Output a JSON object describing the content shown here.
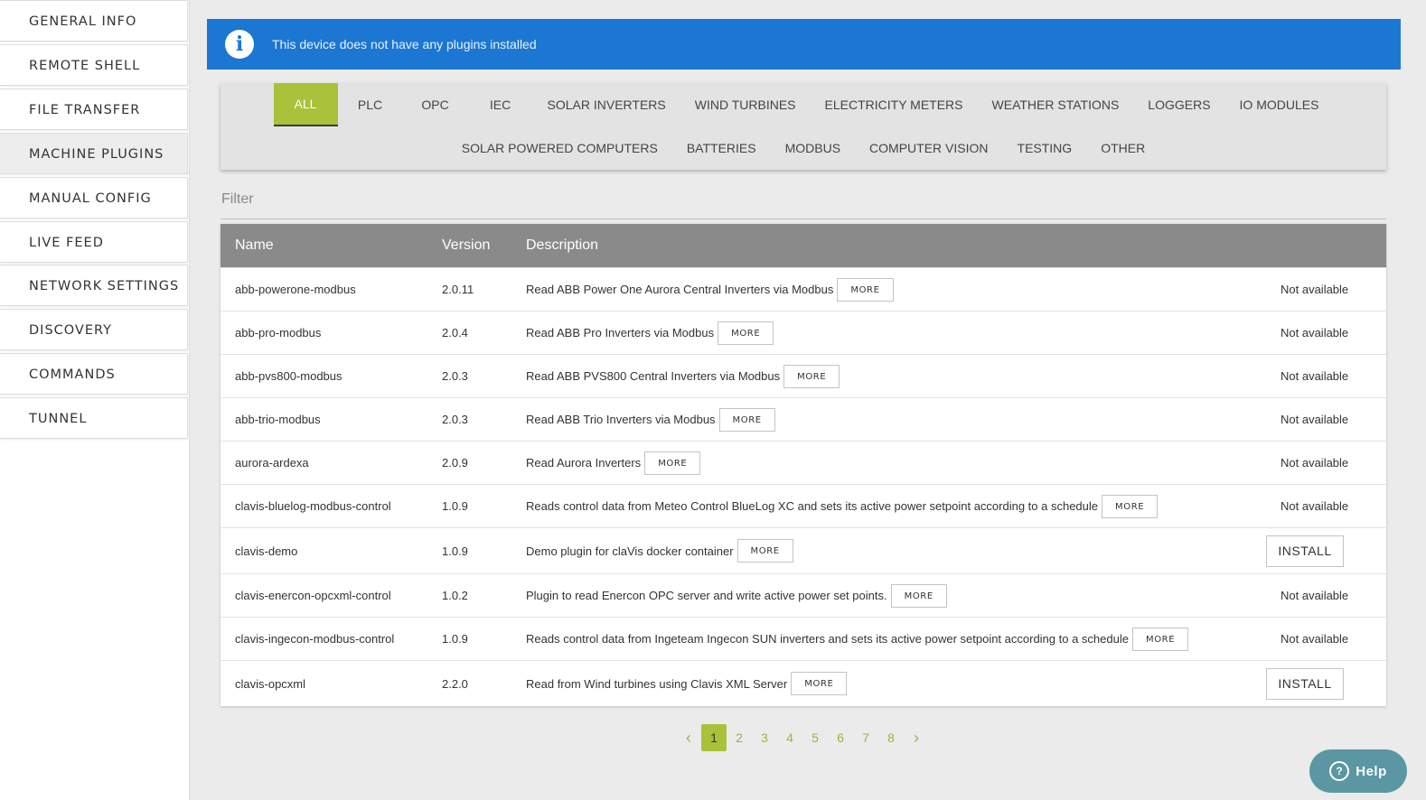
{
  "sidebar": {
    "items": [
      {
        "label": "GENERAL INFO"
      },
      {
        "label": "REMOTE SHELL"
      },
      {
        "label": "FILE TRANSFER"
      },
      {
        "label": "MACHINE PLUGINS"
      },
      {
        "label": "MANUAL CONFIG"
      },
      {
        "label": "LIVE FEED"
      },
      {
        "label": "NETWORK SETTINGS"
      },
      {
        "label": "DISCOVERY"
      },
      {
        "label": "COMMANDS"
      },
      {
        "label": "TUNNEL"
      }
    ],
    "active": "MACHINE PLUGINS"
  },
  "banner": {
    "icon": "info-icon",
    "message": "This device does not have any plugins installed",
    "color": "#1c77d3"
  },
  "categories": {
    "row1": [
      "ALL",
      "PLC",
      "OPC",
      "IEC",
      "SOLAR INVERTERS",
      "WIND TURBINES",
      "ELECTRICITY METERS",
      "WEATHER STATIONS",
      "LOGGERS",
      "IO MODULES"
    ],
    "row2": [
      "SOLAR POWERED COMPUTERS",
      "BATTERIES",
      "MODBUS",
      "COMPUTER VISION",
      "TESTING",
      "OTHER"
    ],
    "active": "ALL",
    "accent_color": "#a8c23b"
  },
  "filter": {
    "placeholder": "Filter",
    "value": ""
  },
  "table": {
    "headers": {
      "name": "Name",
      "version": "Version",
      "description": "Description"
    },
    "more_label": "MORE",
    "rows": [
      {
        "name": "abb-powerone-modbus",
        "version": "2.0.11",
        "description": "Read ABB Power One Aurora Central Inverters via Modbus",
        "status": "Not available"
      },
      {
        "name": "abb-pro-modbus",
        "version": "2.0.4",
        "description": "Read ABB Pro Inverters via Modbus",
        "status": "Not available"
      },
      {
        "name": "abb-pvs800-modbus",
        "version": "2.0.3",
        "description": "Read ABB PVS800 Central Inverters via Modbus",
        "status": "Not available"
      },
      {
        "name": "abb-trio-modbus",
        "version": "2.0.3",
        "description": "Read ABB Trio Inverters via Modbus",
        "status": "Not available"
      },
      {
        "name": "aurora-ardexa",
        "version": "2.0.9",
        "description": "Read Aurora Inverters",
        "status": "Not available"
      },
      {
        "name": "clavis-bluelog-modbus-control",
        "version": "1.0.9",
        "description": "Reads control data from Meteo Control BlueLog XC and sets its active power setpoint according to a schedule",
        "status": "Not available"
      },
      {
        "name": "clavis-demo",
        "version": "1.0.9",
        "description": "Demo plugin for claVis docker container",
        "status": "INSTALL"
      },
      {
        "name": "clavis-enercon-opcxml-control",
        "version": "1.0.2",
        "description": "Plugin to read Enercon OPC server and write active power set points.",
        "status": "Not available"
      },
      {
        "name": "clavis-ingecon-modbus-control",
        "version": "1.0.9",
        "description": "Reads control data from Ingeteam Ingecon SUN inverters and sets its active power setpoint according to a schedule",
        "status": "Not available"
      },
      {
        "name": "clavis-opcxml",
        "version": "2.2.0",
        "description": "Read from Wind turbines using Clavis XML Server",
        "status": "INSTALL"
      }
    ]
  },
  "pagination": {
    "pages": [
      "1",
      "2",
      "3",
      "4",
      "5",
      "6",
      "7",
      "8"
    ],
    "current": "1",
    "prev_icon": "chevron-left-icon",
    "next_icon": "chevron-right-icon"
  },
  "help": {
    "label": "Help",
    "icon": "question-circle-icon",
    "color": "#5a97a3"
  }
}
